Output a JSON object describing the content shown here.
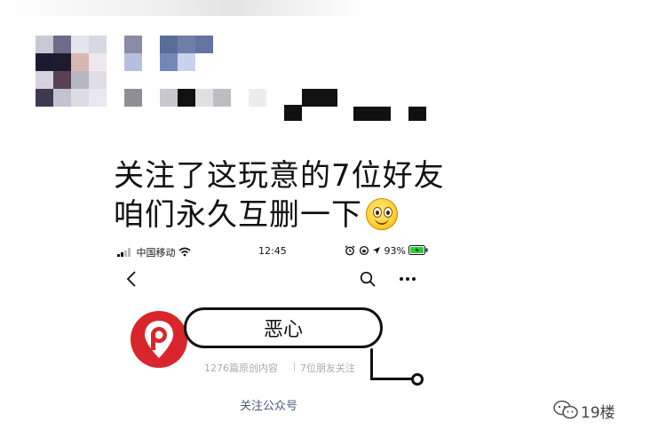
{
  "caption": {
    "line1": "关注了这玩意的7位好友",
    "line2": "咱们永久互删一下"
  },
  "emoji": "smiley-emoji",
  "status_bar": {
    "carrier": "中国移动",
    "time": "12:45",
    "battery": "93%"
  },
  "account": {
    "name": "恶心",
    "articles": "1276篇原创内容",
    "friends_following": "7位朋友关注",
    "follow_label": "关注公众号"
  },
  "watermark": {
    "text": "19楼"
  },
  "colors": {
    "brand_red": "#d8262c",
    "battery_green": "#2ecc40",
    "link_blue_gray": "#4a5b7a"
  }
}
